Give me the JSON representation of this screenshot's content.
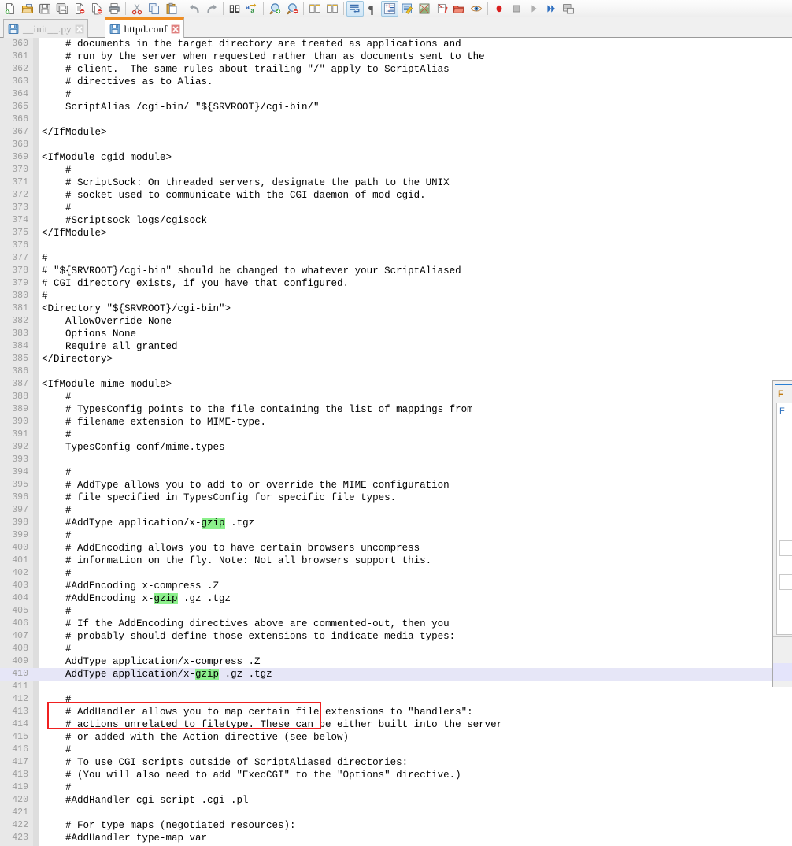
{
  "toolbar": {
    "groups": [
      {
        "items": [
          {
            "name": "new-file-icon",
            "label": "New",
            "active": false
          },
          {
            "name": "open-file-icon",
            "label": "Open",
            "active": false
          },
          {
            "name": "save-icon",
            "label": "Save",
            "active": false
          },
          {
            "name": "save-all-icon",
            "label": "Save All",
            "active": false
          },
          {
            "name": "close-file-icon",
            "label": "Close",
            "active": false
          },
          {
            "name": "close-all-icon",
            "label": "Close All",
            "active": false
          },
          {
            "name": "print-icon",
            "label": "Print",
            "active": false
          }
        ]
      },
      {
        "items": [
          {
            "name": "cut-icon",
            "label": "Cut",
            "active": false
          },
          {
            "name": "copy-icon",
            "label": "Copy",
            "active": false
          },
          {
            "name": "paste-icon",
            "label": "Paste",
            "active": false
          }
        ]
      },
      {
        "items": [
          {
            "name": "undo-icon",
            "label": "Undo",
            "active": false
          },
          {
            "name": "redo-icon",
            "label": "Redo",
            "active": false
          }
        ]
      },
      {
        "items": [
          {
            "name": "find-icon",
            "label": "Find",
            "active": false
          },
          {
            "name": "replace-icon",
            "label": "Replace",
            "active": false
          }
        ]
      },
      {
        "items": [
          {
            "name": "zoom-in-icon",
            "label": "Zoom In",
            "active": false
          },
          {
            "name": "zoom-out-icon",
            "label": "Zoom Out",
            "active": false
          }
        ]
      },
      {
        "items": [
          {
            "name": "sync-scroll-v-icon",
            "label": "Synchronize Vertical Scrolling",
            "active": false
          },
          {
            "name": "sync-scroll-h-icon",
            "label": "Synchronize Horizontal Scrolling",
            "active": false
          }
        ]
      },
      {
        "items": [
          {
            "name": "word-wrap-icon",
            "label": "Word Wrap",
            "active": true
          },
          {
            "name": "show-all-characters-icon",
            "label": "Show All Characters",
            "active": false
          },
          {
            "name": "indent-guide-icon",
            "label": "Show Indent Guide",
            "active": true
          },
          {
            "name": "user-defined-language-icon",
            "label": "User Defined Language",
            "active": false
          },
          {
            "name": "document-map-icon",
            "label": "Document Map",
            "active": false
          },
          {
            "name": "function-list-icon",
            "label": "Function List",
            "active": false
          },
          {
            "name": "folder-workspace-icon",
            "label": "Folder as Workspace",
            "active": false
          },
          {
            "name": "preview-eye-icon",
            "label": "Preview",
            "active": false
          }
        ]
      },
      {
        "items": [
          {
            "name": "record-macro-icon",
            "label": "Start Recording",
            "active": false
          },
          {
            "name": "stop-macro-icon",
            "label": "Stop Recording",
            "active": false
          },
          {
            "name": "play-macro-icon",
            "label": "Playback",
            "active": false
          },
          {
            "name": "run-macro-multiple-icon",
            "label": "Run a Macro Multiple Times",
            "active": false
          },
          {
            "name": "run-icon",
            "label": "Run",
            "active": false
          }
        ]
      }
    ]
  },
  "tabs": [
    {
      "label": "__init__.py",
      "active": false,
      "icon": "floppy-disk-icon",
      "close": "close-tab-icon"
    },
    {
      "label": "httpd.conf",
      "active": true,
      "icon": "floppy-disk-icon",
      "close": "close-tab-icon"
    }
  ],
  "editor": {
    "first_line": 360,
    "current_line": 410,
    "search_term": "gzip",
    "highlight_color": "#8cf08c",
    "current_line_color": "#e6e6f7",
    "annotation_color": "#f02020",
    "lines": [
      {
        "n": 360,
        "text": "    # documents in the target directory are treated as applications and"
      },
      {
        "n": 361,
        "text": "    # run by the server when requested rather than as documents sent to the"
      },
      {
        "n": 362,
        "text": "    # client.  The same rules about trailing \"/\" apply to ScriptAlias"
      },
      {
        "n": 363,
        "text": "    # directives as to Alias."
      },
      {
        "n": 364,
        "text": "    #"
      },
      {
        "n": 365,
        "text": "    ScriptAlias /cgi-bin/ \"${SRVROOT}/cgi-bin/\""
      },
      {
        "n": 366,
        "text": ""
      },
      {
        "n": 367,
        "text": "</IfModule>"
      },
      {
        "n": 368,
        "text": ""
      },
      {
        "n": 369,
        "text": "<IfModule cgid_module>"
      },
      {
        "n": 370,
        "text": "    #"
      },
      {
        "n": 371,
        "text": "    # ScriptSock: On threaded servers, designate the path to the UNIX"
      },
      {
        "n": 372,
        "text": "    # socket used to communicate with the CGI daemon of mod_cgid."
      },
      {
        "n": 373,
        "text": "    #"
      },
      {
        "n": 374,
        "text": "    #Scriptsock logs/cgisock"
      },
      {
        "n": 375,
        "text": "</IfModule>"
      },
      {
        "n": 376,
        "text": ""
      },
      {
        "n": 377,
        "text": "#"
      },
      {
        "n": 378,
        "text": "# \"${SRVROOT}/cgi-bin\" should be changed to whatever your ScriptAliased"
      },
      {
        "n": 379,
        "text": "# CGI directory exists, if you have that configured."
      },
      {
        "n": 380,
        "text": "#"
      },
      {
        "n": 381,
        "text": "<Directory \"${SRVROOT}/cgi-bin\">"
      },
      {
        "n": 382,
        "text": "    AllowOverride None"
      },
      {
        "n": 383,
        "text": "    Options None"
      },
      {
        "n": 384,
        "text": "    Require all granted"
      },
      {
        "n": 385,
        "text": "</Directory>"
      },
      {
        "n": 386,
        "text": ""
      },
      {
        "n": 387,
        "text": "<IfModule mime_module>"
      },
      {
        "n": 388,
        "text": "    #"
      },
      {
        "n": 389,
        "text": "    # TypesConfig points to the file containing the list of mappings from"
      },
      {
        "n": 390,
        "text": "    # filename extension to MIME-type."
      },
      {
        "n": 391,
        "text": "    #"
      },
      {
        "n": 392,
        "text": "    TypesConfig conf/mime.types"
      },
      {
        "n": 393,
        "text": ""
      },
      {
        "n": 394,
        "text": "    #"
      },
      {
        "n": 395,
        "text": "    # AddType allows you to add to or override the MIME configuration"
      },
      {
        "n": 396,
        "text": "    # file specified in TypesConfig for specific file types."
      },
      {
        "n": 397,
        "text": "    #"
      },
      {
        "n": 398,
        "text": "    #AddType application/x-gzip .tgz"
      },
      {
        "n": 399,
        "text": "    #"
      },
      {
        "n": 400,
        "text": "    # AddEncoding allows you to have certain browsers uncompress"
      },
      {
        "n": 401,
        "text": "    # information on the fly. Note: Not all browsers support this."
      },
      {
        "n": 402,
        "text": "    #"
      },
      {
        "n": 403,
        "text": "    #AddEncoding x-compress .Z"
      },
      {
        "n": 404,
        "text": "    #AddEncoding x-gzip .gz .tgz"
      },
      {
        "n": 405,
        "text": "    #"
      },
      {
        "n": 406,
        "text": "    # If the AddEncoding directives above are commented-out, then you"
      },
      {
        "n": 407,
        "text": "    # probably should define those extensions to indicate media types:"
      },
      {
        "n": 408,
        "text": "    #"
      },
      {
        "n": 409,
        "text": "    AddType application/x-compress .Z"
      },
      {
        "n": 410,
        "text": "    AddType application/x-gzip .gz .tgz"
      },
      {
        "n": 411,
        "text": ""
      },
      {
        "n": 412,
        "text": "    #"
      },
      {
        "n": 413,
        "text": "    # AddHandler allows you to map certain file extensions to \"handlers\":"
      },
      {
        "n": 414,
        "text": "    # actions unrelated to filetype. These can be either built into the server"
      },
      {
        "n": 415,
        "text": "    # or added with the Action directive (see below)"
      },
      {
        "n": 416,
        "text": "    #"
      },
      {
        "n": 417,
        "text": "    # To use CGI scripts outside of ScriptAliased directories:"
      },
      {
        "n": 418,
        "text": "    # (You will also need to add \"ExecCGI\" to the \"Options\" directive.)"
      },
      {
        "n": 419,
        "text": "    #"
      },
      {
        "n": 420,
        "text": "    #AddHandler cgi-script .cgi .pl"
      },
      {
        "n": 421,
        "text": ""
      },
      {
        "n": 422,
        "text": "    # For type maps (negotiated resources):"
      },
      {
        "n": 423,
        "text": "    #AddHandler type-map var"
      }
    ]
  },
  "right_panel": {
    "title": "F",
    "group_label": "F"
  }
}
